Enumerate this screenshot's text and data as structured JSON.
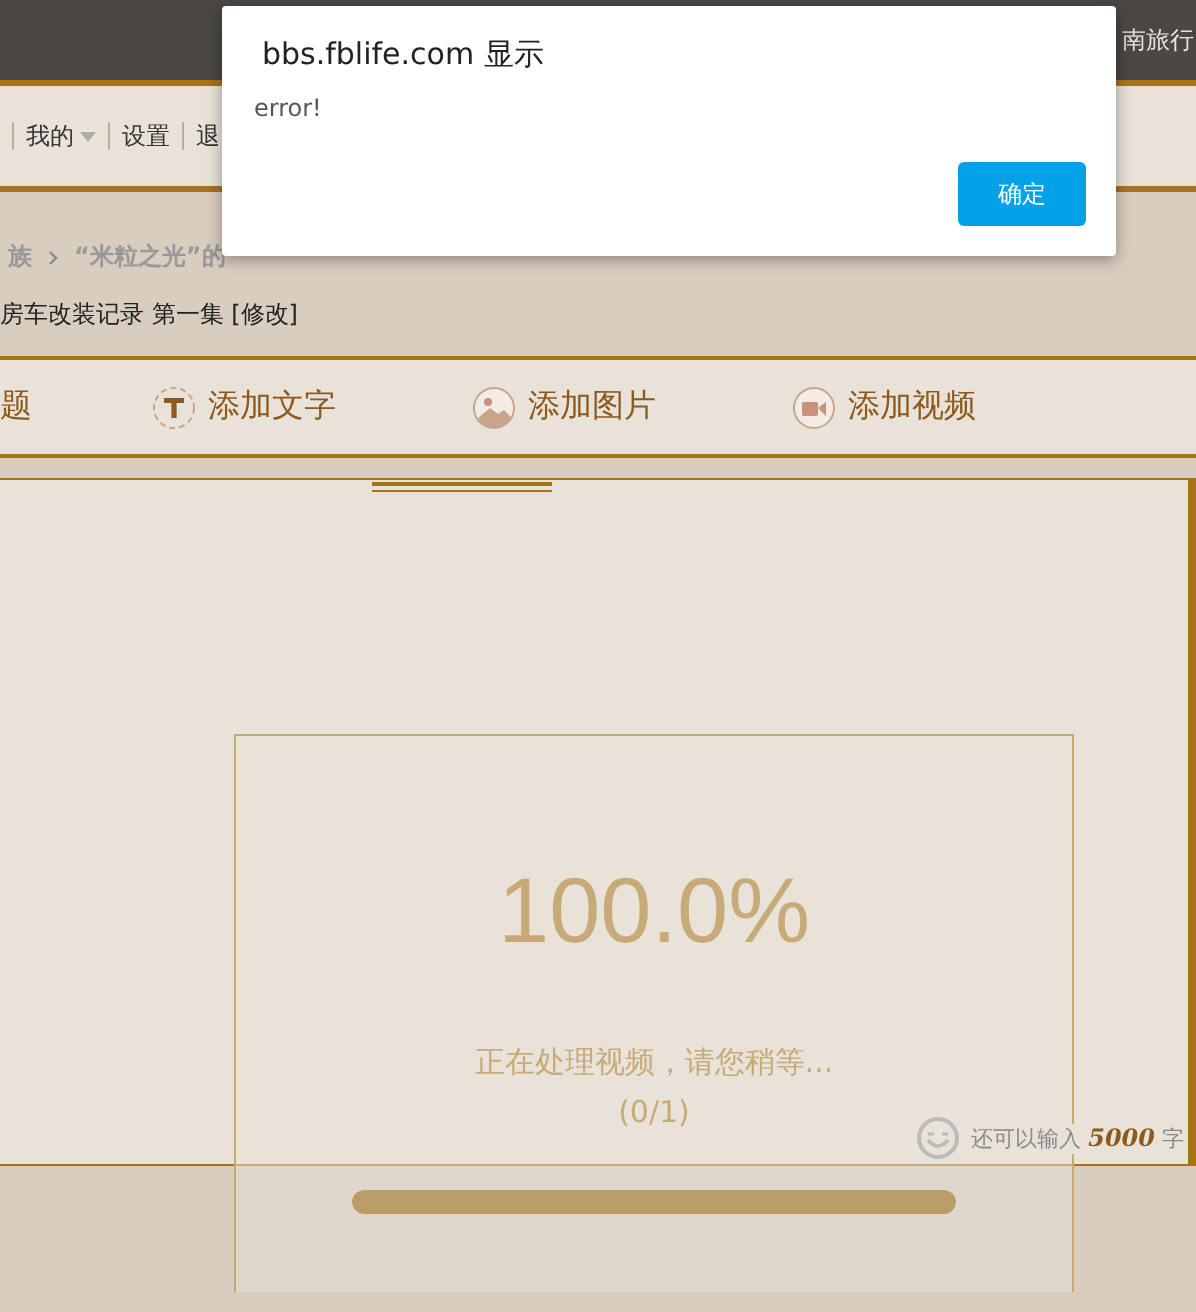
{
  "top_bar": {
    "text": "南旅行"
  },
  "nav": {
    "items": [
      {
        "label": "我的",
        "dropdown": true
      },
      {
        "label": "设置",
        "dropdown": false
      },
      {
        "label": "退",
        "dropdown": false
      }
    ]
  },
  "breadcrumb": [
    "族",
    "“米粒之光”的"
  ],
  "post_title": "房车改装记录 第一集 [修改]",
  "toolbar": [
    {
      "label": "题",
      "kind": "title"
    },
    {
      "label": "添加文字",
      "kind": "text"
    },
    {
      "label": "添加图片",
      "kind": "image"
    },
    {
      "label": "添加视频",
      "kind": "video"
    }
  ],
  "counter": {
    "prefix": "还可以输入",
    "count": "5000",
    "suffix": "字"
  },
  "upload": {
    "percent": "100.0%",
    "message": "正在处理视频，请您稍等...",
    "count": "(0/1)",
    "level": 1
  },
  "dialog": {
    "title": "bbs.fblife.com 显示",
    "message": "error!",
    "button": "确定"
  }
}
